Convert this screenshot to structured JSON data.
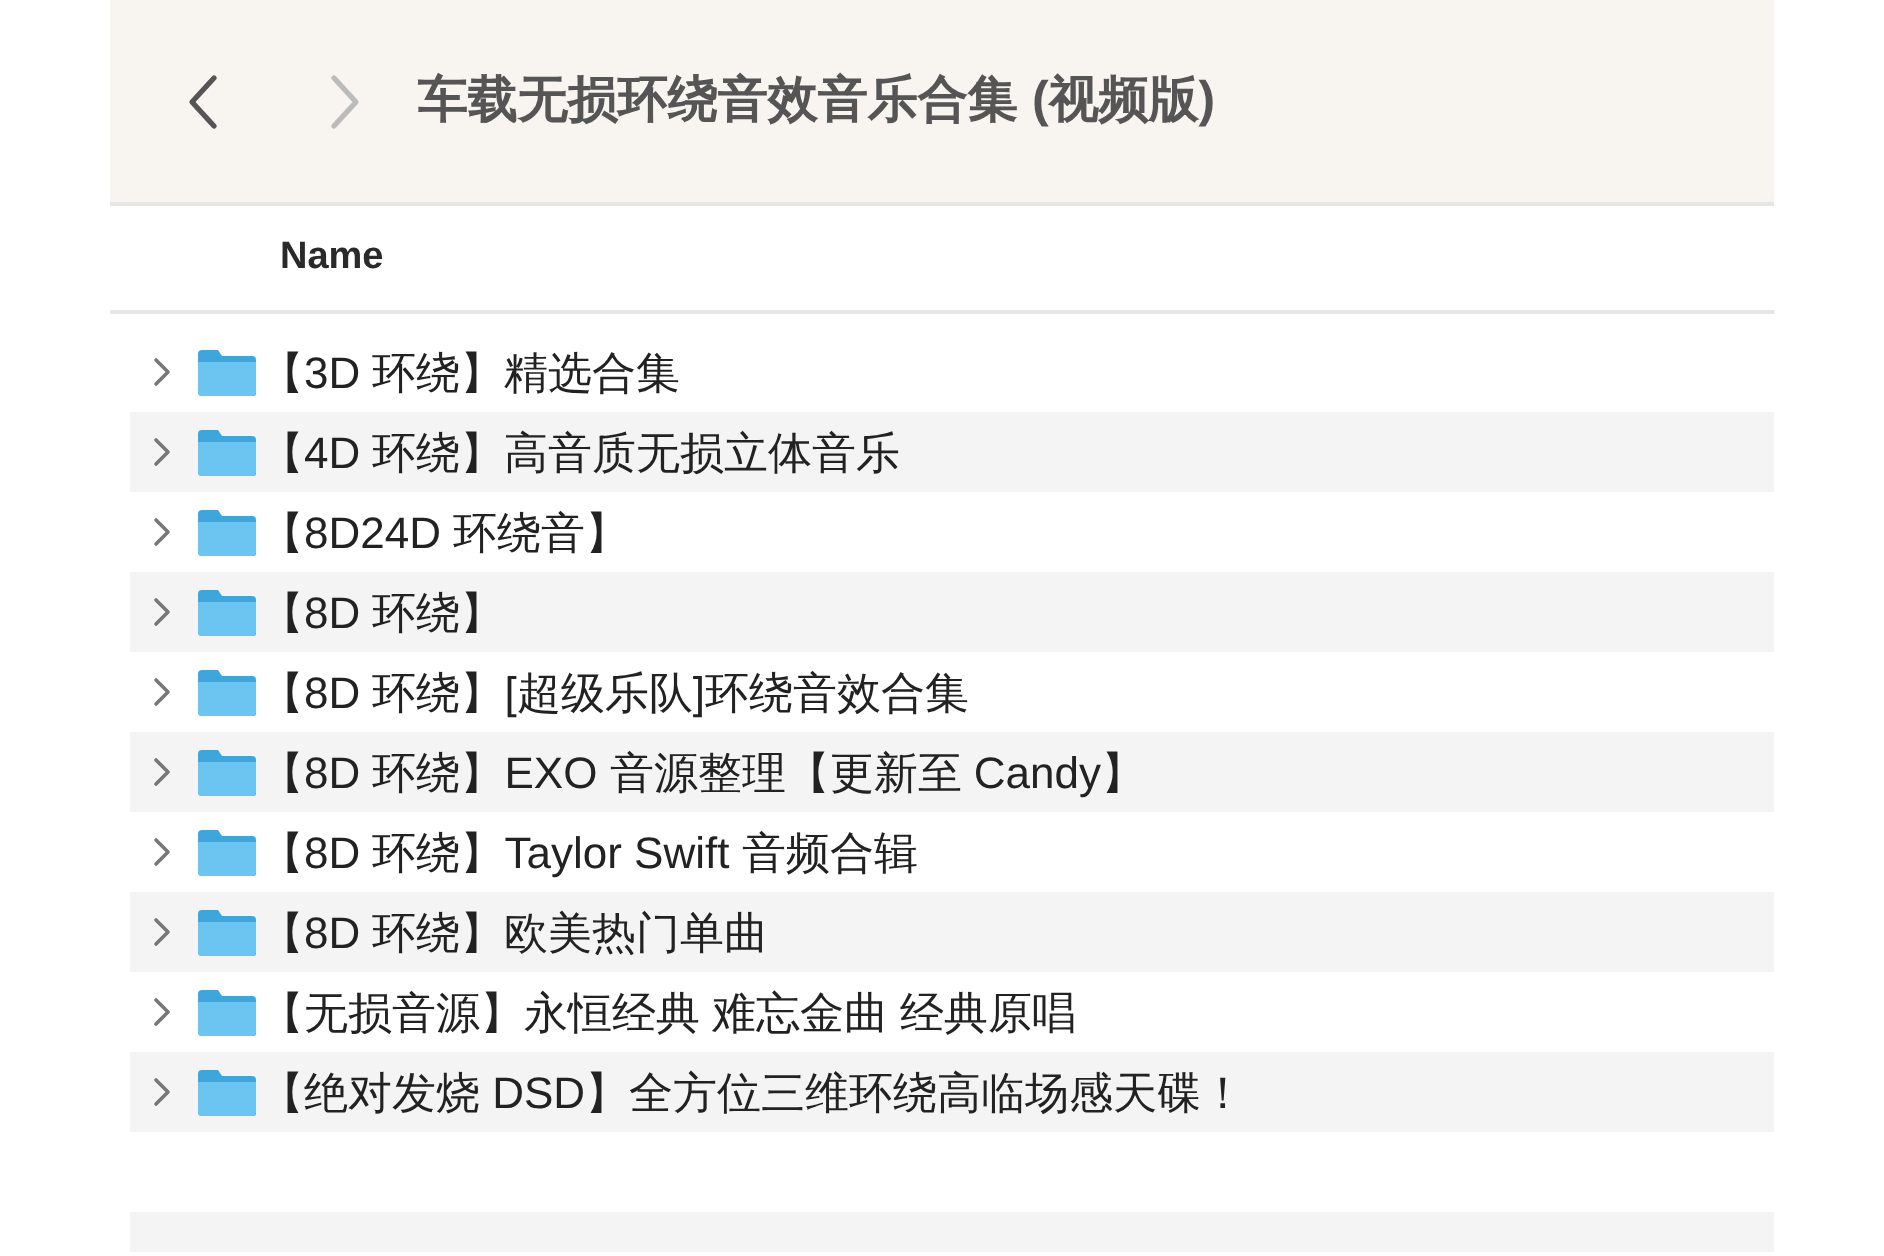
{
  "toolbar": {
    "back": {
      "disabled": false
    },
    "forward": {
      "disabled": true
    },
    "title": "车载无损环绕音效音乐合集 (视频版)"
  },
  "columns": [
    {
      "label": "Name"
    }
  ],
  "rows": [
    {
      "name": "【3D 环绕】精选合集",
      "expanded": false
    },
    {
      "name": "【4D 环绕】高音质无损立体音乐",
      "expanded": false
    },
    {
      "name": "【8D24D 环绕音】",
      "expanded": false
    },
    {
      "name": "【8D 环绕】",
      "expanded": false
    },
    {
      "name": "【8D 环绕】[超级乐队]环绕音效合集",
      "expanded": false
    },
    {
      "name": "【8D 环绕】EXO 音源整理【更新至 Candy】",
      "expanded": false
    },
    {
      "name": "【8D 环绕】Taylor Swift 音频合辑",
      "expanded": false
    },
    {
      "name": "【8D 环绕】欧美热门单曲",
      "expanded": false
    },
    {
      "name": "【无损音源】永恒经典 难忘金曲 经典原唱",
      "expanded": false
    },
    {
      "name": "【绝对发烧 DSD】全方位三维环绕高临场感天碟！",
      "expanded": false
    }
  ]
}
